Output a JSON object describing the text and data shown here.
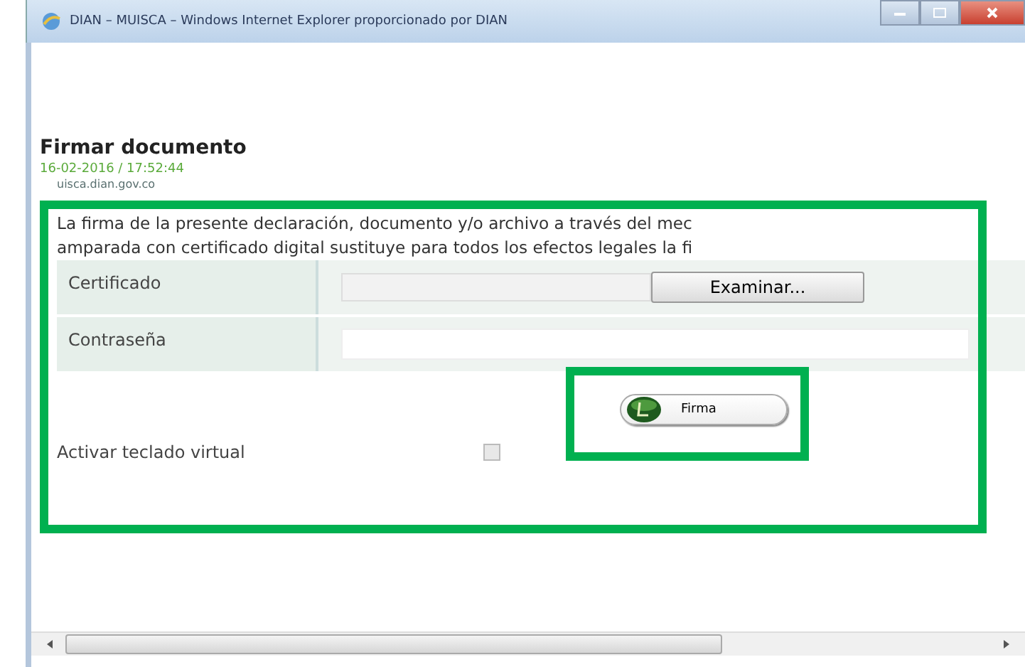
{
  "window": {
    "title": "DIAN – MUISCA – Windows Internet Explorer proporcionado por DIAN"
  },
  "page": {
    "heading": "Firmar documento",
    "timestamp": "16-02-2016 / 17:52:44",
    "domain": "uisca.dian.gov.co",
    "notice": [
      "La firma de la presente declaración, documento y/o archivo a través del mec",
      "amparada con certificado digital sustituye para todos los efectos legales la fi"
    ]
  },
  "form": {
    "rows": [
      {
        "kind": "file",
        "label": "Certificado",
        "button": "Examinar..."
      },
      {
        "kind": "password",
        "label": "Contraseña"
      }
    ],
    "sign_button": "Firma",
    "virtual_keyboard": {
      "label": "Activar teclado virtual",
      "checked": false
    }
  }
}
